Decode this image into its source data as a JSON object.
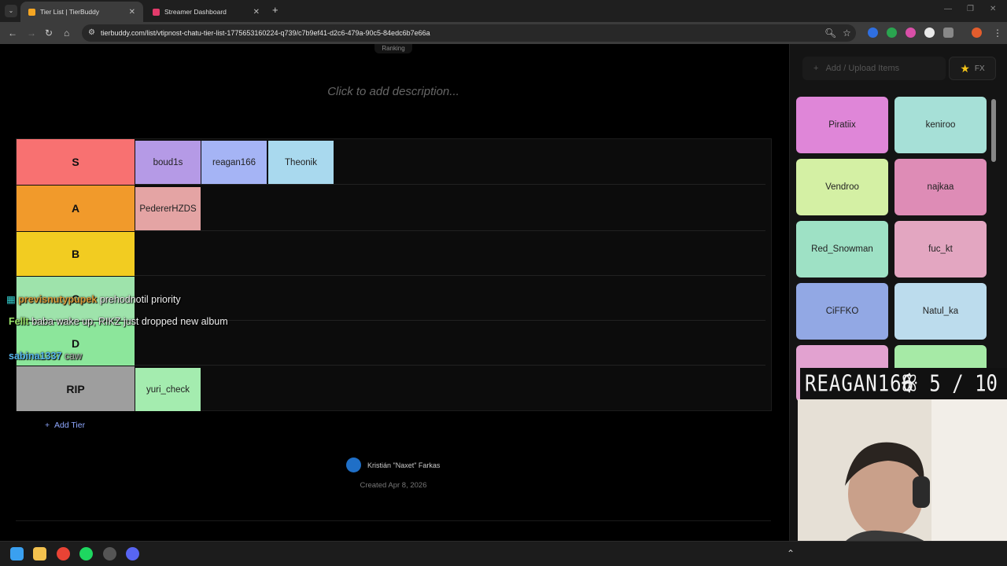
{
  "browser": {
    "tabs": [
      {
        "title": "Tier List | TierBuddy",
        "active": true
      },
      {
        "title": "Streamer Dashboard",
        "active": false
      }
    ],
    "url": "tierbuddy.com/list/vtipnost-chatu-tier-list-1775653160224-q739/c7b9ef41-d2c6-479a-90c5-84edc6b7e66a"
  },
  "page": {
    "ranking_label": "Ranking",
    "description_placeholder": "Click to add description...",
    "tiers": [
      {
        "label": "S",
        "color": "#f87171",
        "items": [
          {
            "name": "boud1s",
            "color": "#b59ae6"
          },
          {
            "name": "reagan166",
            "color": "#a5b4f5"
          },
          {
            "name": "Theonik",
            "color": "#a9d9ee"
          }
        ]
      },
      {
        "label": "A",
        "color": "#f19a2b",
        "items": [
          {
            "name": "PedererHZDS",
            "color": "#e4a4a4"
          }
        ]
      },
      {
        "label": "B",
        "color": "#f2cc21",
        "items": []
      },
      {
        "label": "C",
        "color": "#9ee3ab",
        "items": []
      },
      {
        "label": "D",
        "color": "#8ce69b",
        "items": []
      },
      {
        "label": "RIP",
        "color": "#9e9e9e",
        "items": [
          {
            "name": "yuri_check",
            "color": "#a4ecaf"
          }
        ]
      }
    ],
    "add_tier_label": "Add Tier",
    "author": "Kristián \"Naxet\" Farkas",
    "created": "Created Apr 8, 2026"
  },
  "panel": {
    "upload_label": "Add / Upload Items",
    "fx_label": "FX",
    "items": [
      {
        "name": "Piratiix",
        "color": "#df86d8"
      },
      {
        "name": "keniroo",
        "color": "#a6e0d7"
      },
      {
        "name": "Vendroo",
        "color": "#d4f0a4"
      },
      {
        "name": "najkaa",
        "color": "#de8cb6"
      },
      {
        "name": "Red_Snowman",
        "color": "#9ee1c5"
      },
      {
        "name": "fuc_kt",
        "color": "#e3a6c1"
      },
      {
        "name": "CiFFKO",
        "color": "#92a8e4"
      },
      {
        "name": "Natul_ka",
        "color": "#bcdced"
      },
      {
        "name": "",
        "color": "#e2a2d0"
      },
      {
        "name": "",
        "color": "#a6eaa6"
      }
    ]
  },
  "chat_overlay": [
    {
      "user": "previsnutypupek",
      "text": "prehodnotil priority",
      "user_color": "#d99a3a"
    },
    {
      "user": "Fellt",
      "text": "baba wake up, RIKZ just dropped new album",
      "user_color": "#9be36a"
    },
    {
      "user": "sabina1337",
      "text": "caw",
      "user_color": "#57b7ee"
    }
  ],
  "stream_overlay": {
    "name": "REAGAN166",
    "score": "5 / 10"
  }
}
